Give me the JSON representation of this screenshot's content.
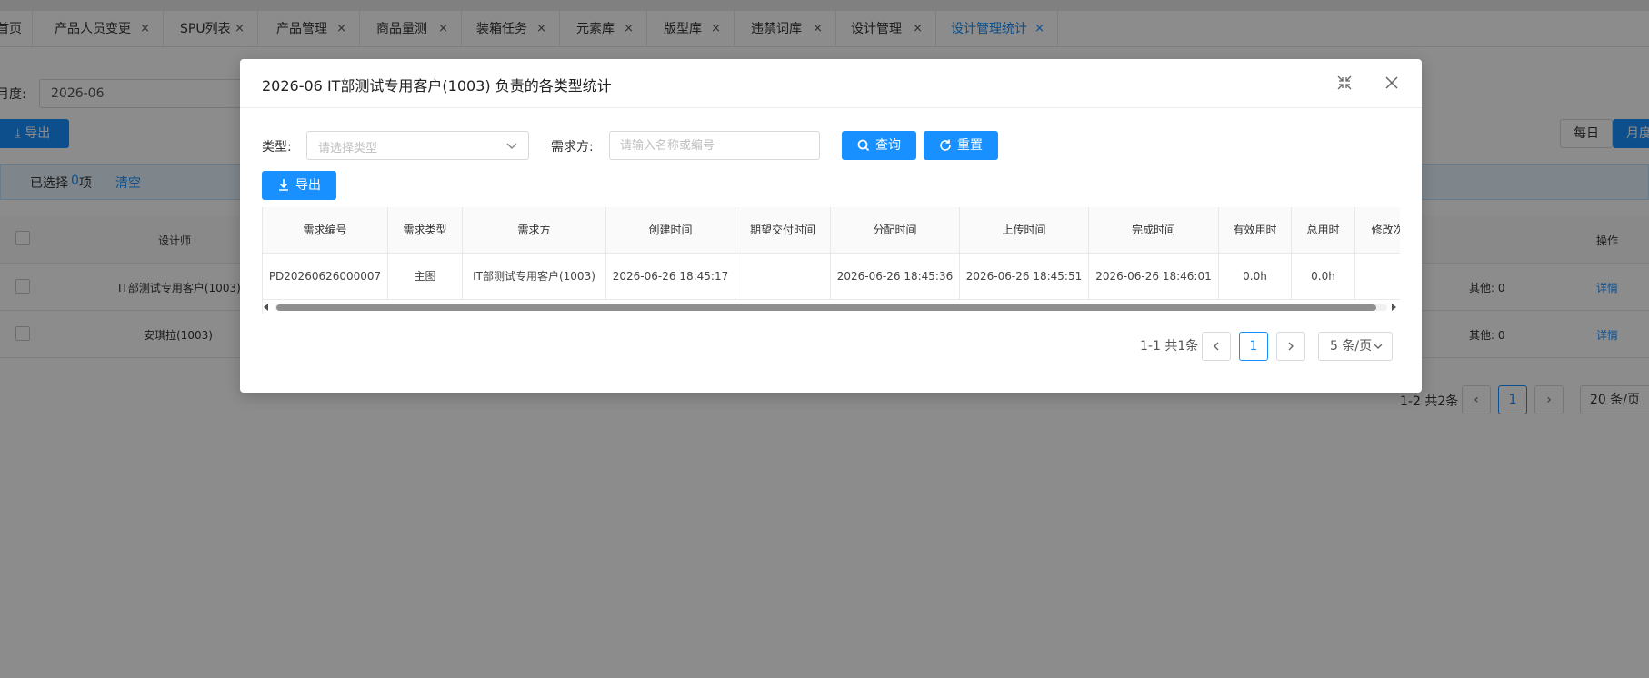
{
  "tabs": [
    {
      "label": "首页",
      "active": false,
      "closable": false
    },
    {
      "label": "产品人员变更",
      "active": false,
      "closable": true
    },
    {
      "label": "SPU列表",
      "active": false,
      "closable": true
    },
    {
      "label": "产品管理",
      "active": false,
      "closable": true
    },
    {
      "label": "商品量测",
      "active": false,
      "closable": true
    },
    {
      "label": "装箱任务",
      "active": false,
      "closable": true
    },
    {
      "label": "元素库",
      "active": false,
      "closable": true
    },
    {
      "label": "版型库",
      "active": false,
      "closable": true
    },
    {
      "label": "违禁词库",
      "active": false,
      "closable": true
    },
    {
      "label": "设计管理",
      "active": false,
      "closable": true
    },
    {
      "label": "设计管理统计",
      "active": true,
      "closable": true
    }
  ],
  "tab_close_glyph": "×",
  "background": {
    "month_label": "月度:",
    "month_value": "2026-06",
    "export_label": "导出",
    "daily_label": "每日",
    "monthly_label": "月度",
    "selected_prefix": "已选择",
    "selected_count": "0",
    "selected_suffix": "项",
    "clear_label": "清空",
    "columns": {
      "designer": "设计师",
      "action": "操作"
    },
    "rows": [
      {
        "designer": "IT部测试专用客户(1003)",
        "other": "其他: 0",
        "action": "详情"
      },
      {
        "designer": "安琪拉(1003)",
        "other": "其他: 0",
        "action": "详情"
      }
    ],
    "pagination": {
      "total": "1-2 共2条",
      "page": "1",
      "size": "20 条/页"
    }
  },
  "modal": {
    "title": "2026-06 IT部测试专用客户(1003) 负责的各类型统计",
    "filters": {
      "type_label": "类型:",
      "type_placeholder": "请选择类型",
      "demander_label": "需求方:",
      "demander_placeholder": "请输入名称或编号"
    },
    "buttons": {
      "query": "查询",
      "reset": "重置",
      "export": "导出"
    },
    "table": {
      "headers": [
        "需求编号",
        "需求类型",
        "需求方",
        "创建时间",
        "期望交付时间",
        "分配时间",
        "上传时间",
        "完成时间",
        "有效用时",
        "总用时",
        "修改次数"
      ],
      "rows": [
        [
          "PD20260626000007",
          "主图",
          "IT部测试专用客户(1003)",
          "2026-06-26 18:45:17",
          "",
          "2026-06-26 18:45:36",
          "2026-06-26 18:45:51",
          "2026-06-26 18:46:01",
          "0.0h",
          "0.0h",
          ""
        ]
      ]
    },
    "pagination": {
      "total": "1-1 共1条",
      "page": "1",
      "size": "5 条/页"
    }
  },
  "colors": {
    "primary": "#1890ff",
    "mask": "rgba(0,0,0,0.45)"
  }
}
